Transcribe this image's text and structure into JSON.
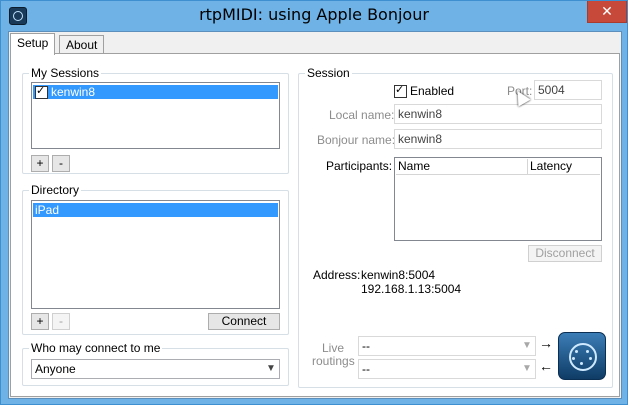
{
  "window": {
    "title": "rtpMIDI: using Apple Bonjour",
    "close_label": "✕"
  },
  "tabs": [
    {
      "label": "Setup",
      "active": true
    },
    {
      "label": "About",
      "active": false
    }
  ],
  "my_sessions": {
    "label": "My Sessions",
    "items": [
      {
        "label": "kenwin8",
        "checked": true,
        "selected": true
      }
    ],
    "add_label": "+",
    "remove_label": "-"
  },
  "directory": {
    "label": "Directory",
    "items": [
      {
        "label": "iPad",
        "selected": true
      }
    ],
    "add_label": "+",
    "remove_label": "-",
    "connect_label": "Connect"
  },
  "who_may_connect": {
    "label": "Who may connect to me",
    "value": "Anyone"
  },
  "session": {
    "label": "Session",
    "enabled_label": "Enabled",
    "enabled": true,
    "port_label": "Port:",
    "port_value": "5004",
    "local_name_label": "Local name:",
    "local_name_value": "kenwin8",
    "bonjour_name_label": "Bonjour name:",
    "bonjour_name_value": "kenwin8",
    "participants_label": "Participants:",
    "participants_columns": [
      "Name",
      "Latency"
    ],
    "disconnect_label": "Disconnect",
    "address_label": "Address:",
    "address_line1": "kenwin8:5004",
    "address_line2": "192.168.1.13:5004",
    "live_routings_label_1": "Live",
    "live_routings_label_2": "routings",
    "routing_in_value": "--",
    "routing_out_value": "--",
    "arrow_right": "→",
    "arrow_left": "←"
  },
  "icons": {
    "app": "rtpmidi-app-icon",
    "midi": "midi-connector-icon"
  },
  "colors": {
    "title_bar": "#6eb2e6",
    "close_button": "#c7493a",
    "selection": "#3399ff"
  }
}
